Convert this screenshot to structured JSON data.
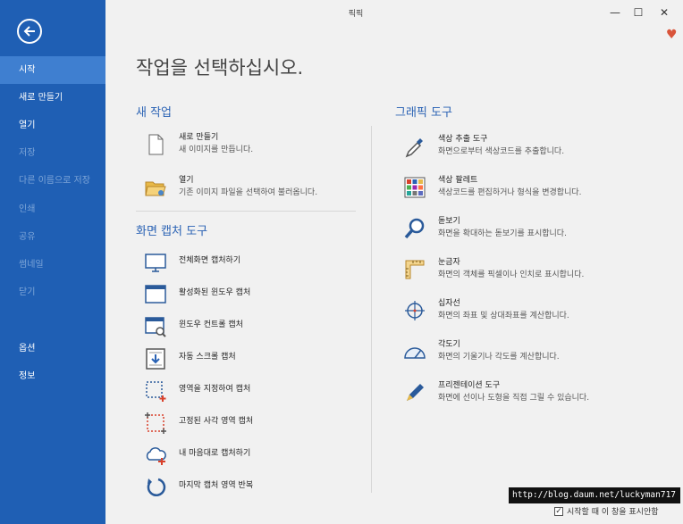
{
  "window": {
    "title": "픽픽",
    "minimize": "—",
    "maximize": "☐",
    "close": "✕"
  },
  "sidebar": {
    "items": [
      {
        "label": "시작",
        "state": "active"
      },
      {
        "label": "새로 만들기",
        "state": "normal"
      },
      {
        "label": "열기",
        "state": "normal"
      },
      {
        "label": "저장",
        "state": "disabled"
      },
      {
        "label": "다른 이름으로 저장",
        "state": "disabled"
      },
      {
        "label": "인쇄",
        "state": "disabled"
      },
      {
        "label": "공유",
        "state": "disabled"
      },
      {
        "label": "썸네일",
        "state": "disabled"
      },
      {
        "label": "닫기",
        "state": "disabled"
      },
      {
        "label": "옵션",
        "state": "normal"
      },
      {
        "label": "정보",
        "state": "normal"
      }
    ]
  },
  "main": {
    "title": "작업을 선택하십시오.",
    "new_task": {
      "heading": "새 작업",
      "items": [
        {
          "title": "새로 만들기",
          "desc": "새 이미지를 만듭니다.",
          "icon": "new-file-icon"
        },
        {
          "title": "열기",
          "desc": "기존 이미지 파일을 선택하여 불러옵니다.",
          "icon": "open-folder-icon"
        }
      ]
    },
    "capture": {
      "heading": "화면 캡처 도구",
      "items": [
        {
          "title": "전체화면 캡처하기",
          "icon": "monitor-icon"
        },
        {
          "title": "활성화된 윈도우 캡처",
          "icon": "window-icon"
        },
        {
          "title": "윈도우 컨트롤 캡처",
          "icon": "window-magnifier-icon"
        },
        {
          "title": "자동 스크롤 캡처",
          "icon": "scroll-capture-icon"
        },
        {
          "title": "영역을 지정하여 캡처",
          "icon": "region-select-icon"
        },
        {
          "title": "고정된 사각 영역 캡처",
          "icon": "fixed-region-icon"
        },
        {
          "title": "내 마음대로 캡처하기",
          "icon": "freehand-cloud-icon"
        },
        {
          "title": "마지막 캡처 영역 반복",
          "icon": "repeat-icon"
        }
      ]
    },
    "graphic": {
      "heading": "그래픽 도구",
      "items": [
        {
          "title": "색상 추출 도구",
          "desc": "화면으로부터 색상코드를 추출합니다.",
          "icon": "eyedropper-icon"
        },
        {
          "title": "색상 팔레트",
          "desc": "색상코드를 편집하거나 형식을 변경합니다.",
          "icon": "palette-icon"
        },
        {
          "title": "돋보기",
          "desc": "화면을 확대하는 돋보기를 표시합니다.",
          "icon": "magnifier-icon"
        },
        {
          "title": "눈금자",
          "desc": "화면의 객체를 픽셀이나 인치로 표시합니다.",
          "icon": "ruler-icon"
        },
        {
          "title": "십자선",
          "desc": "화면의 좌표 및 상대좌표를 계산합니다.",
          "icon": "crosshair-icon"
        },
        {
          "title": "각도기",
          "desc": "화면의 기울기나 각도를 계산합니다.",
          "icon": "protractor-icon"
        },
        {
          "title": "프리젠테이션 도구",
          "desc": "화면에 선이나 도형을 직접 그릴 수 있습니다.",
          "icon": "pen-icon"
        }
      ]
    }
  },
  "watermark": "http://blog.daum.net/luckyman717",
  "startup": {
    "label": "시작할 때 이 창을 표시안함",
    "checked": true,
    "check_mark": "✓"
  },
  "colors": {
    "sidebar": "#1f5fb4",
    "sidebar_active": "#3f7fd0",
    "accent": "#2a62b4",
    "heart": "#d9543a"
  }
}
